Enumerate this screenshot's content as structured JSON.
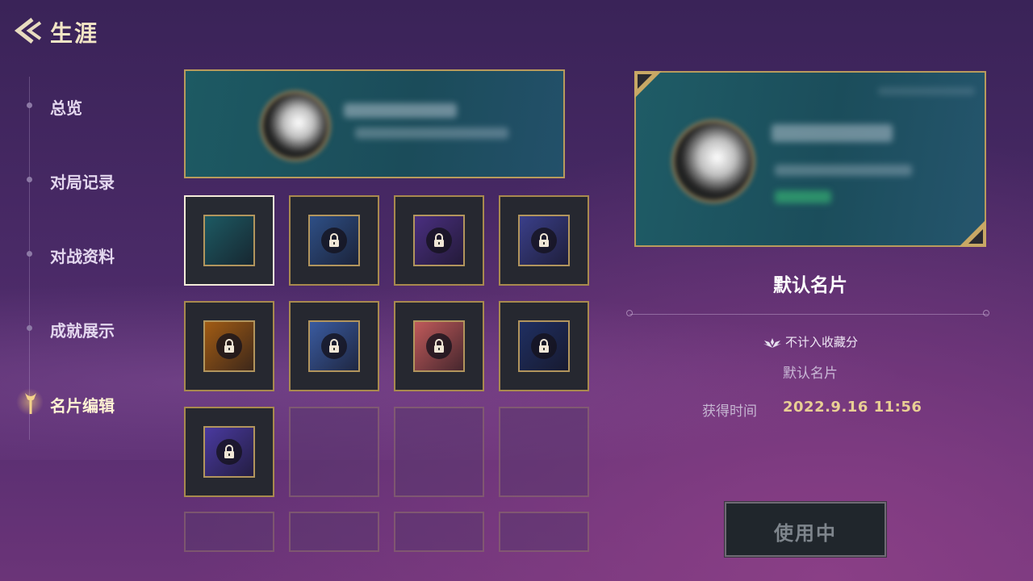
{
  "header": {
    "title": "生涯"
  },
  "sidebar": {
    "items": [
      {
        "label": "总览",
        "active": false
      },
      {
        "label": "对局记录",
        "active": false
      },
      {
        "label": "对战资料",
        "active": false
      },
      {
        "label": "成就展示",
        "active": false
      },
      {
        "label": "名片编辑",
        "active": true
      }
    ]
  },
  "grid": {
    "cards": [
      {
        "state": "selected",
        "locked": false,
        "color": "#1d5a63"
      },
      {
        "state": "owned",
        "locked": true,
        "color": "#2e4f86"
      },
      {
        "state": "owned",
        "locked": true,
        "color": "#4a2f80"
      },
      {
        "state": "owned",
        "locked": true,
        "color": "#3a3f8a"
      },
      {
        "state": "owned",
        "locked": true,
        "color": "#a25c14"
      },
      {
        "state": "owned",
        "locked": true,
        "color": "#3a5ba0"
      },
      {
        "state": "owned",
        "locked": true,
        "color": "#c05a5a"
      },
      {
        "state": "owned",
        "locked": true,
        "color": "#1f2f62"
      },
      {
        "state": "owned",
        "locked": true,
        "color": "#4a3aa0"
      },
      {
        "state": "empty"
      },
      {
        "state": "empty"
      },
      {
        "state": "empty"
      },
      {
        "state": "empty"
      },
      {
        "state": "empty"
      },
      {
        "state": "empty"
      },
      {
        "state": "empty"
      }
    ]
  },
  "detail": {
    "name": "默认名片",
    "collection_note": "不计入收藏分",
    "sub_name": "默认名片",
    "time_label": "获得时间",
    "time_value": "2022.9.16  11:56",
    "use_button_label": "使用中"
  },
  "colors": {
    "accent_gold": "#b99b5c",
    "preview_teal": "#1d5a63",
    "bg_purple": "#4a2a67"
  }
}
